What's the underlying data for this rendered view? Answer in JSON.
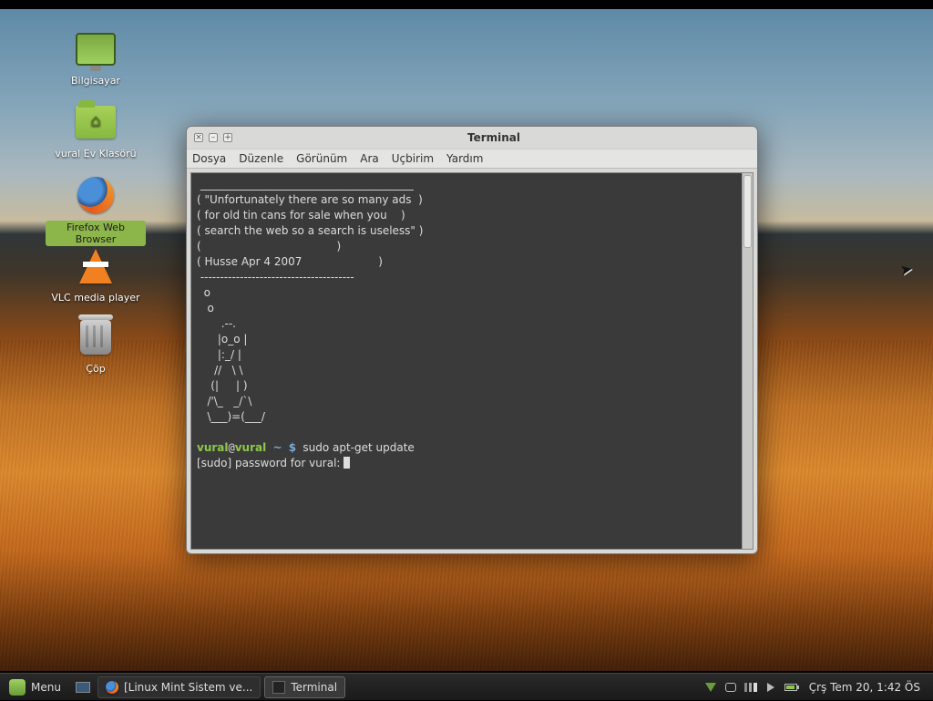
{
  "desktop": {
    "icons": [
      {
        "name": "computer",
        "label": "Bilgisayar",
        "selected": false
      },
      {
        "name": "home",
        "label": "vural Ev Klasörü",
        "selected": false
      },
      {
        "name": "firefox",
        "label": "Firefox Web Browser",
        "selected": true
      },
      {
        "name": "vlc",
        "label": "VLC media player",
        "selected": false
      },
      {
        "name": "trash",
        "label": "Çöp",
        "selected": false
      }
    ]
  },
  "terminal": {
    "title": "Terminal",
    "menu": [
      "Dosya",
      "Düzenle",
      "Görünüm",
      "Ara",
      "Uçbirim",
      "Yardım"
    ],
    "motd": [
      " _______________________________________",
      "( \"Unfortunately there are so many ads  )",
      "( for old tin cans for sale when you    )",
      "( search the web so a search is useless\" )",
      "(                                       )",
      "( Husse Apr 4 2007                      )",
      " ---------------------------------------",
      "  o",
      "   o",
      "       .--.",
      "      |o_o |",
      "      |:_/ |",
      "     //   \\ \\",
      "    (|     | )",
      "   /'\\_   _/`\\",
      "   \\___)=(___/",
      ""
    ],
    "prompt": {
      "user": "vural",
      "host": "vural",
      "path": "~",
      "symbol": "$"
    },
    "command": "sudo apt-get update",
    "sudo_line": "[sudo] password for vural: "
  },
  "panel": {
    "menu_label": "Menu",
    "tasks": [
      {
        "id": "firefox-task",
        "label": "[Linux Mint Sistem ve...",
        "active": false
      },
      {
        "id": "terminal-task",
        "label": "Terminal",
        "active": true
      }
    ],
    "clock": "Çrş Tem 20, 1:42 ÖS"
  }
}
